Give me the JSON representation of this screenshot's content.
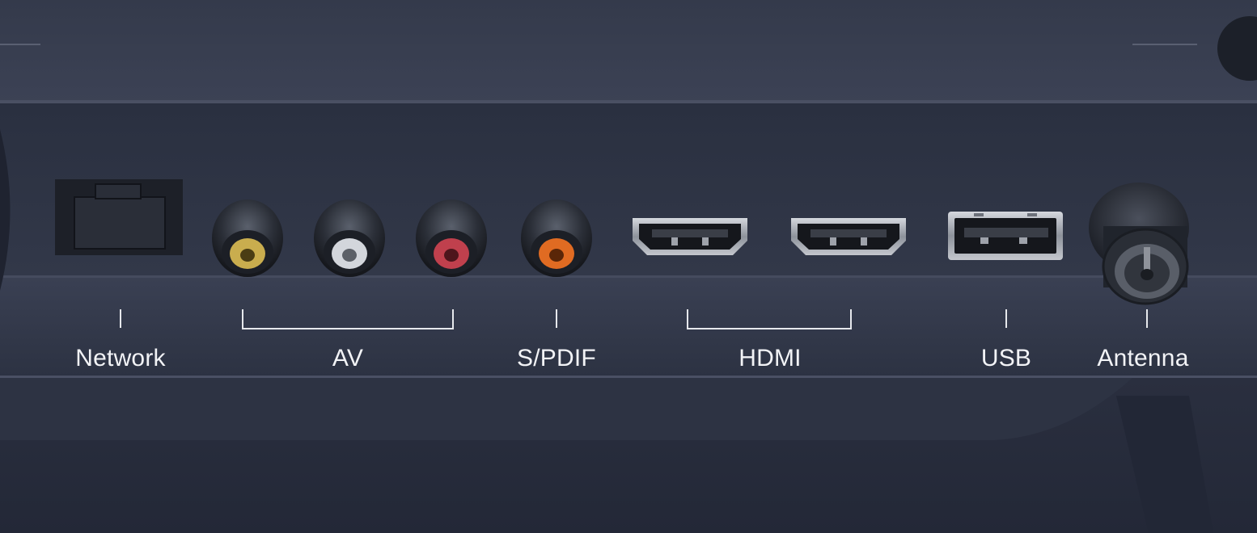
{
  "ports": [
    {
      "id": "network",
      "label": "Network"
    },
    {
      "id": "av",
      "label": "AV"
    },
    {
      "id": "spdif",
      "label": "S/PDIF"
    },
    {
      "id": "hdmi",
      "label": "HDMI"
    },
    {
      "id": "usb",
      "label": "USB"
    },
    {
      "id": "antenna",
      "label": "Antenna"
    }
  ],
  "colors": {
    "panel": "#2e3444",
    "av_video": "#c9ad4e",
    "av_audio_left": "#d3d6dc",
    "av_audio_right": "#c0404d",
    "spdif": "#e06b22",
    "label_text": "#f2f3f6"
  }
}
